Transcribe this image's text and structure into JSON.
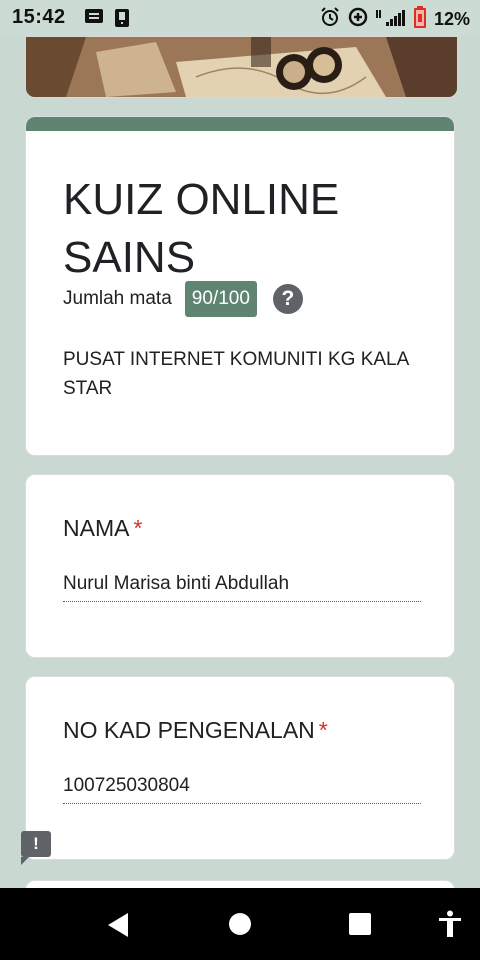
{
  "status_bar": {
    "time": "15:42",
    "battery": "12%",
    "icons": [
      "message-icon",
      "sim-icon",
      "alarm-icon",
      "data-saver-icon",
      "signal-icon",
      "battery-icon"
    ]
  },
  "form": {
    "title": "KUIZ ONLINE SAINS",
    "points_label": "Jumlah mata",
    "points_value": "90/100",
    "description": "PUSAT INTERNET KOMUNITI KG KALA STAR",
    "accent_color": "#5f8572",
    "questions": [
      {
        "label": "NAMA",
        "required_mark": "*",
        "answer": "Nurul Marisa binti Abdullah"
      },
      {
        "label": "NO KAD PENGENALAN",
        "required_mark": "*",
        "answer": "100725030804"
      }
    ]
  },
  "nav": {
    "icons": [
      "back-icon",
      "home-icon",
      "recents-icon",
      "accessibility-icon"
    ]
  }
}
